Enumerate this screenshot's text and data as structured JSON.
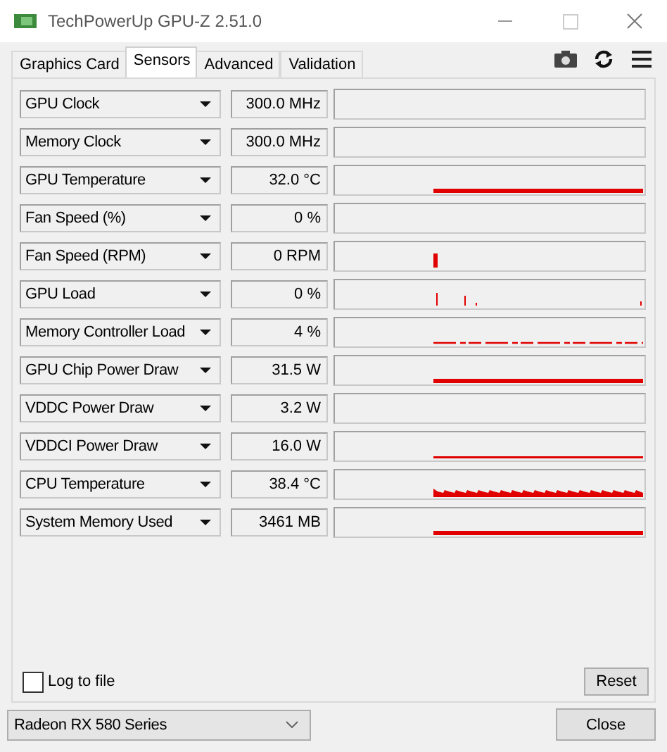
{
  "window": {
    "title": "TechPowerUp GPU-Z 2.51.0"
  },
  "tabs": [
    {
      "label": "Graphics Card",
      "selected": false
    },
    {
      "label": "Sensors",
      "selected": true
    },
    {
      "label": "Advanced",
      "selected": false
    },
    {
      "label": "Validation",
      "selected": false
    }
  ],
  "sensors": [
    {
      "name": "GPU Clock",
      "reading": "300.0 MHz",
      "kind": "empty"
    },
    {
      "name": "Memory Clock",
      "reading": "300.0 MHz",
      "kind": "empty"
    },
    {
      "name": "GPU Temperature",
      "reading": "32.0 °C",
      "kind": "thick"
    },
    {
      "name": "Fan Speed (%)",
      "reading": "0 %",
      "kind": "empty"
    },
    {
      "name": "Fan Speed (RPM)",
      "reading": "0 RPM",
      "kind": "blip"
    },
    {
      "name": "GPU Load",
      "reading": "0 %",
      "kind": "spikes"
    },
    {
      "name": "Memory Controller Load",
      "reading": "4 %",
      "kind": "dashed"
    },
    {
      "name": "GPU Chip Power Draw",
      "reading": "31.5 W",
      "kind": "thick"
    },
    {
      "name": "VDDC Power Draw",
      "reading": "3.2 W",
      "kind": "empty"
    },
    {
      "name": "VDDCI Power Draw",
      "reading": "16.0 W",
      "kind": "thin"
    },
    {
      "name": "CPU Temperature",
      "reading": "38.4 °C",
      "kind": "sawtooth"
    },
    {
      "name": "System Memory Used",
      "reading": "3461 MB",
      "kind": "thick"
    }
  ],
  "log_to_file": {
    "label": "Log to file",
    "checked": false
  },
  "reset_button": "Reset",
  "device_select": {
    "value": "Radeon RX 580 Series"
  },
  "close_button": "Close"
}
